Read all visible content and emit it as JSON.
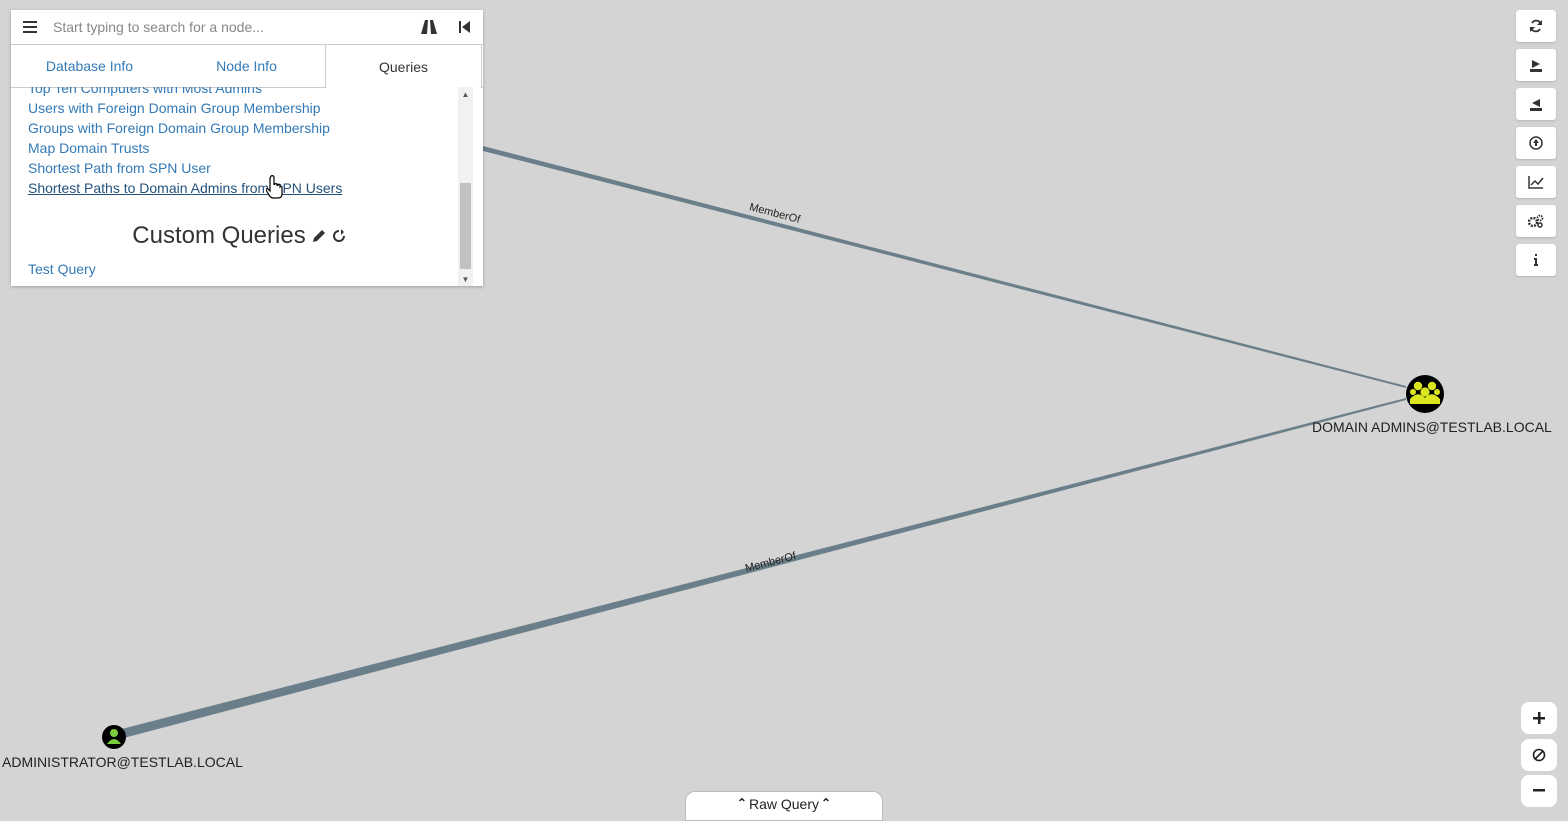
{
  "search": {
    "placeholder": "Start typing to search for a node..."
  },
  "tabs": [
    {
      "label": "Database Info"
    },
    {
      "label": "Node Info"
    },
    {
      "label": "Queries"
    }
  ],
  "queries": [
    "Top Ten Computers with Most Admins",
    "Users with Foreign Domain Group Membership",
    "Groups with Foreign Domain Group Membership",
    "Map Domain Trusts",
    "Shortest Path from SPN User",
    "Shortest Paths to Domain Admins from SPN Users"
  ],
  "custom_queries": {
    "title": "Custom Queries",
    "items": [
      "Test Query"
    ]
  },
  "graph": {
    "nodes": {
      "domain_admins": {
        "label": "DOMAIN ADMINS@TESTLAB.LOCAL",
        "type": "group"
      },
      "administrator": {
        "label": "ADMINISTRATOR@TESTLAB.LOCAL",
        "type": "user"
      }
    },
    "edges": [
      {
        "label": "MemberOf"
      },
      {
        "label": "MemberOf"
      }
    ]
  },
  "raw_query": {
    "label": "Raw Query"
  },
  "colors": {
    "background": "#d4d4d4",
    "edge": "#6b7f8a",
    "group_node": "#dbe61f",
    "user_node": "#7ccd3c",
    "link": "#337ab7"
  },
  "toolbar_icons": [
    "refresh-icon",
    "export-icon",
    "import-icon",
    "upload-icon",
    "chart-icon",
    "settings-icon",
    "info-icon"
  ],
  "zoom_icons": [
    "zoom-in-icon",
    "zoom-reset-icon",
    "zoom-out-icon"
  ]
}
